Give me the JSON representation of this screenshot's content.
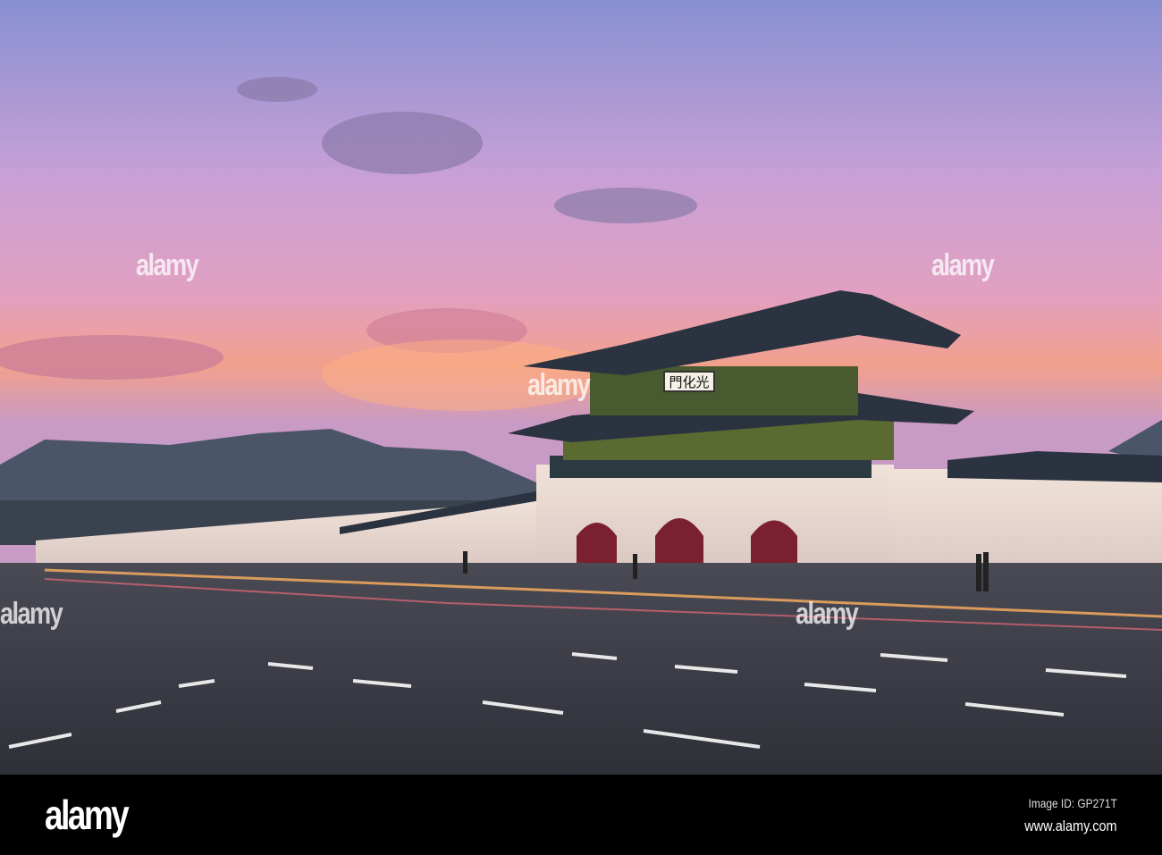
{
  "photo": {
    "subject": "Gwanghwamun gate at sunset",
    "signboard_text": "門化光",
    "colors": {
      "sky_top": "#8a8fd0",
      "sky_mid": "#d89cc8",
      "sky_glow": "#f09a80",
      "road": "#3a3d45",
      "wall": "#e8d8cc",
      "roof": "#2c3340"
    }
  },
  "watermark": {
    "text": "alamy"
  },
  "footer": {
    "logo": "alamy",
    "image_id": "Image ID: GP271T",
    "url": "www.alamy.com"
  }
}
